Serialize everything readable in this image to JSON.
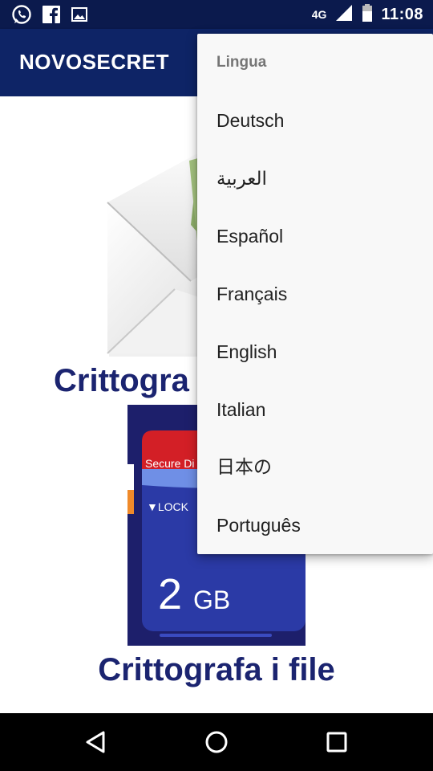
{
  "status_bar": {
    "network": "4G",
    "time": "11:08",
    "notification_icons": [
      "whatsapp-icon",
      "facebook-icon",
      "gallery-icon"
    ]
  },
  "app_bar": {
    "title": "NOVOSECRET"
  },
  "main": {
    "features": [
      {
        "label": "Crittografa i messaggi",
        "visible_label": "Crittogra",
        "icon": "envelope-icon"
      },
      {
        "label": "Crittografa i file",
        "icon": "sd-card-icon"
      }
    ],
    "sd_card": {
      "brand": "Secure Di",
      "lock": "▼LOCK",
      "capacity_number": "2",
      "capacity_unit": "GB"
    }
  },
  "language_menu": {
    "header": "Lingua",
    "items": [
      "Deutsch",
      "العربية",
      "Español",
      "Français",
      "English",
      "Italian",
      "日本の",
      "Português"
    ]
  },
  "colors": {
    "status_bar": "#0b1a4d",
    "app_bar": "#0e2466",
    "feature_text": "#1b2470",
    "menu_background": "#f8f8f8"
  }
}
